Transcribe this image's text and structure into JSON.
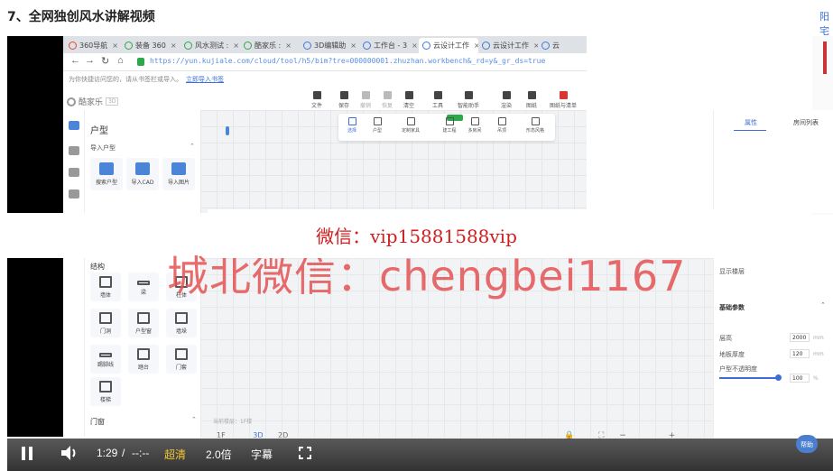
{
  "page": {
    "heading": "7、全网独创风水讲解视频",
    "top_right_cut": "阳宅"
  },
  "browser": {
    "tabs": [
      {
        "label": "360导航"
      },
      {
        "label": "装备 360"
      },
      {
        "label": "风水测试 :"
      },
      {
        "label": "酷家乐 :"
      },
      {
        "label": "3D编辑助"
      },
      {
        "label": "工作台 - 3"
      },
      {
        "label": "云设计工作",
        "active": true
      },
      {
        "label": "云设计工作"
      },
      {
        "label": "云"
      }
    ],
    "url": "https://yun.kujiale.com/cloud/tool/h5/bim?tre=000000001.zhuzhan.workbench&_rd=y&_gr_ds=true",
    "infobar_text": "为你快捷访问您的，请从书签栏或导入。",
    "infobar_link": "立即导入书签"
  },
  "app": {
    "brand": "酷家乐",
    "brand_tag": "3D",
    "toolbar": [
      "文件",
      "保存",
      "撤销",
      "恢复",
      "清空",
      "工具",
      "智能助手",
      "渲染",
      "图纸",
      "图纸与清单"
    ],
    "float_toolbar": [
      "选择",
      "户型",
      "定制家具",
      "建工程",
      "多房间",
      "吊顶",
      "形态风格"
    ],
    "left_panel": {
      "title": "户型",
      "section": "导入户型",
      "tiles": [
        "搜索户型",
        "导入CAD",
        "导入图片"
      ]
    },
    "right_panel_tabs": [
      "属性",
      "房间列表"
    ]
  },
  "watermark": "微信：vip15881588vip",
  "overlay_watermark": "城北微信：chengbei1167",
  "lower": {
    "structure_title": "结构",
    "structure_tiles": [
      "墙体",
      "梁",
      "柱体",
      "门洞",
      "户型窗",
      "墙垛",
      "踢脚线",
      "踏台",
      "门套",
      "楼梯"
    ],
    "door_title": "门窗",
    "floor_label": "当前楼层：1F楼",
    "bottom_tools": [
      "1F",
      "3D",
      "2D"
    ],
    "right": {
      "row1_label": "显示楼层",
      "section": "基础参数",
      "height_label": "层高",
      "height_value": "2000",
      "height_unit": "mm",
      "floor_thickness_label": "地板厚度",
      "floor_thickness_value": "120",
      "floor_thickness_unit": "mm",
      "wall_label": "户型不透明度",
      "wall_value": "100",
      "wall_unit": "%",
      "wall_opacity_level": 1.0
    },
    "help": "帮助"
  },
  "player": {
    "time": "1:29",
    "duration": "--:--",
    "quality": "超清",
    "speed": "2.0倍",
    "subtitle": "字幕",
    "progress": 0.1
  }
}
